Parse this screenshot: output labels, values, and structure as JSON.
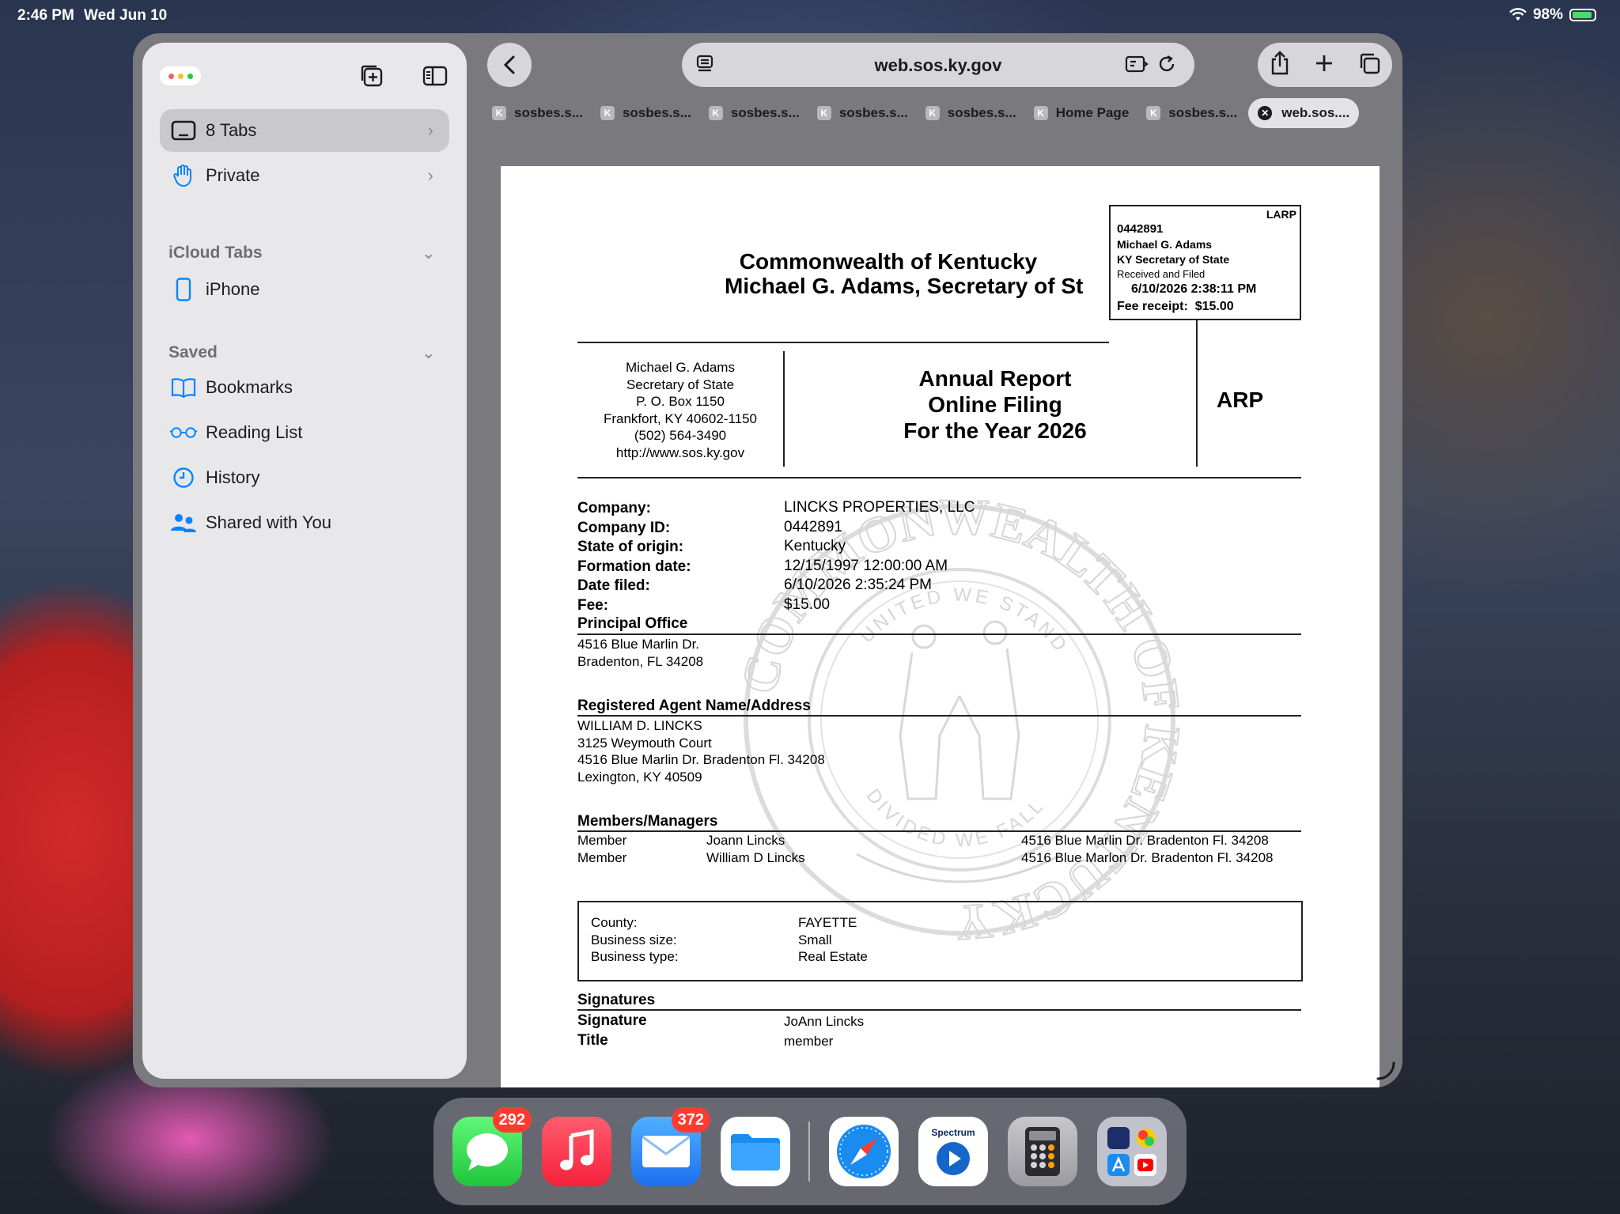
{
  "status": {
    "time": "2:46 PM",
    "date": "Wed Jun 10",
    "battery": "98%"
  },
  "sidebar": {
    "tabs_label": "8 Tabs",
    "private_label": "Private",
    "icloud_header": "iCloud Tabs",
    "iphone_label": "iPhone",
    "saved_header": "Saved",
    "items": [
      "Bookmarks",
      "Reading List",
      "History",
      "Shared with You"
    ]
  },
  "toolbar": {
    "url": "web.sos.ky.gov"
  },
  "tabs": [
    "sosbes.s...",
    "sosbes.s...",
    "sosbes.s...",
    "sosbes.s...",
    "sosbes.s...",
    "Home Page",
    "sosbes.s...",
    "web.sos...."
  ],
  "document": {
    "header_line1": "Commonwealth of Kentucky",
    "header_line2": "Michael G. Adams, Secretary of St",
    "stamp": {
      "code": "LARP",
      "id": "0442891",
      "name": "Michael G. Adams",
      "office": "KY Secretary of State",
      "received": "Received and Filed",
      "datetime": "6/10/2026 2:38:11 PM",
      "fee": "Fee receipt:  $15.00"
    },
    "address": [
      "Michael G. Adams",
      "Secretary of State",
      "P. O. Box 1150",
      "Frankfort, KY 40602-1150",
      "(502) 564-3490",
      "http://www.sos.ky.gov"
    ],
    "report_title": [
      "Annual Report",
      "Online Filing",
      "For the Year 2026"
    ],
    "report_code": "ARP",
    "fields": [
      {
        "label": "Company:",
        "value": "LINCKS PROPERTIES, LLC"
      },
      {
        "label": "Company ID:",
        "value": "0442891"
      },
      {
        "label": "State of origin:",
        "value": "Kentucky"
      },
      {
        "label": "Formation date:",
        "value": "12/15/1997 12:00:00 AM"
      },
      {
        "label": "Date filed:",
        "value": "6/10/2026 2:35:24 PM"
      },
      {
        "label": "Fee:",
        "value": "$15.00"
      }
    ],
    "principal_office_header": "Principal Office",
    "principal_office": [
      "4516 Blue Marlin Dr.",
      "Bradenton, FL 34208"
    ],
    "agent_header": "Registered Agent Name/Address",
    "agent": [
      "WILLIAM D. LINCKS",
      "3125 Weymouth Court",
      "4516 Blue Marlin Dr. Bradenton Fl. 34208",
      "Lexington, KY 40509"
    ],
    "members_header": "Members/Managers",
    "members": [
      {
        "role": "Member",
        "name": "Joann Lincks",
        "address": "4516 Blue Marlin Dr. Bradenton Fl. 34208"
      },
      {
        "role": "Member",
        "name": "William D Lincks",
        "address": "4516 Blue Marlon Dr. Bradenton Fl. 34208"
      }
    ],
    "business": [
      {
        "label": "County:",
        "value": "FAYETTE"
      },
      {
        "label": "Business size:",
        "value": "Small"
      },
      {
        "label": "Business type:",
        "value": "Real Estate"
      }
    ],
    "signatures_header": "Signatures",
    "signature_label": "Signature",
    "signature_value": "JoAnn Lincks",
    "title_label": "Title",
    "title_value": "member",
    "seal_text_top": "COMMONWEALTH OF KENTUCKY",
    "seal_text_inner_top": "UNITED WE STAND",
    "seal_text_inner_bottom": "DIVIDED WE FALL"
  },
  "dock": {
    "messages_badge": "292",
    "mail_badge": "372",
    "spectrum_label": "Spectrum"
  }
}
